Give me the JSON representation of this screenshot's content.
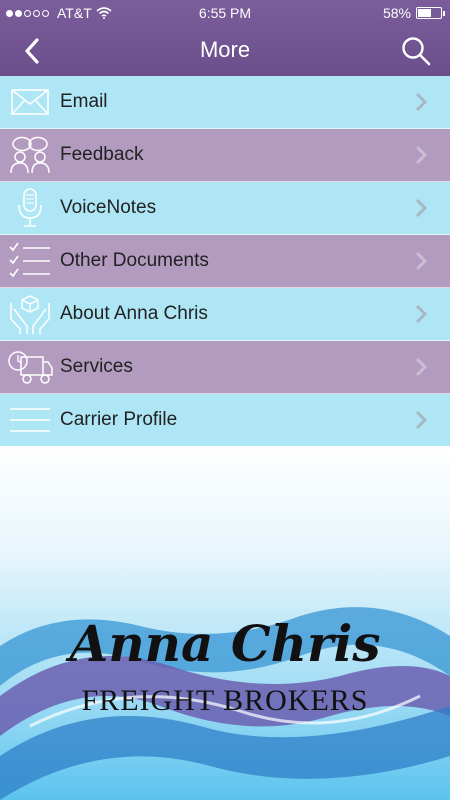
{
  "status_bar": {
    "carrier": "AT&T",
    "time": "6:55 PM",
    "battery": "58%",
    "battery_level": 0.58,
    "signal_bars": 2
  },
  "navbar": {
    "title": "More",
    "back_icon": "chevron-left-icon",
    "search_icon": "search-icon"
  },
  "menu": {
    "items": [
      {
        "label": "Email",
        "icon": "envelope-icon"
      },
      {
        "label": "Feedback",
        "icon": "people-chat-icon"
      },
      {
        "label": "VoiceNotes",
        "icon": "microphone-icon"
      },
      {
        "label": "Other Documents",
        "icon": "checklist-icon"
      },
      {
        "label": "About Anna Chris",
        "icon": "hands-box-icon"
      },
      {
        "label": "Services",
        "icon": "delivery-truck-icon"
      },
      {
        "label": "Carrier Profile",
        "icon": "lines-icon"
      }
    ]
  },
  "brand": {
    "script": "Anna Chris",
    "subtitle": "FREIGHT BROKERS"
  },
  "colors": {
    "nav_bg": "#6b4f8c",
    "row_light": "#aee6f5",
    "row_dark": "#b39bc0"
  }
}
